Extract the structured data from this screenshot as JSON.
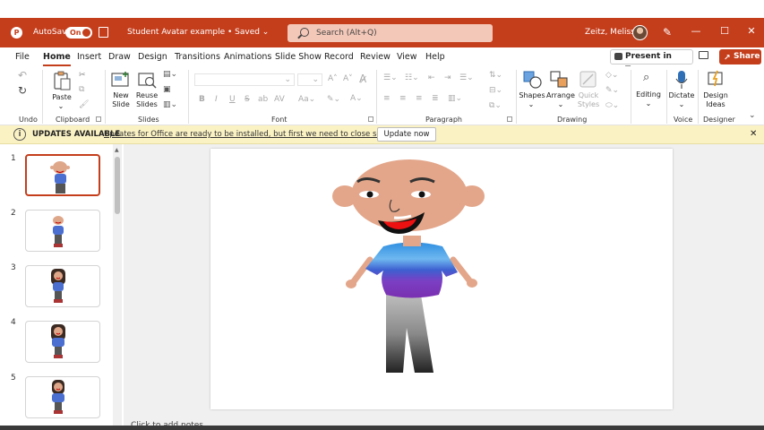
{
  "titlebar": {
    "autosave_label": "AutoSave",
    "autosave_state": "On",
    "doc_title": "Student Avatar example • Saved",
    "search_placeholder": "Search (Alt+Q)",
    "user_name": "Zeitz, Melissa",
    "accent_color": "#c43e1c"
  },
  "tabs": {
    "items": [
      "File",
      "Home",
      "Insert",
      "Draw",
      "Design",
      "Transitions",
      "Animations",
      "Slide Show",
      "Record",
      "Review",
      "View",
      "Help"
    ],
    "active": "Home",
    "present_label": "Present in Teams",
    "share_label": "Share"
  },
  "ribbon": {
    "groups": {
      "undo": "Undo",
      "clipboard": "Clipboard",
      "slides": "Slides",
      "font": "Font",
      "paragraph": "Paragraph",
      "drawing": "Drawing",
      "voice": "Voice",
      "designer": "Designer"
    },
    "buttons": {
      "paste": "Paste",
      "new_slide_1": "New",
      "new_slide_2": "Slide",
      "reuse_1": "Reuse",
      "reuse_2": "Slides",
      "shapes": "Shapes",
      "arrange": "Arrange",
      "quick_styles_1": "Quick",
      "quick_styles_2": "Styles",
      "editing": "Editing",
      "dictate": "Dictate",
      "design_ideas_1": "Design",
      "design_ideas_2": "Ideas"
    },
    "font_buttons": [
      "B",
      "I",
      "U",
      "S",
      "ab",
      "AV"
    ]
  },
  "update_bar": {
    "title": "UPDATES AVAILABLE",
    "message": "Updates for Office are ready to be installed, but first we need to close some apps.",
    "button": "Update now",
    "close": "✕"
  },
  "thumbnails": [
    {
      "number": "1",
      "selected": true
    },
    {
      "number": "2",
      "selected": false
    },
    {
      "number": "3",
      "selected": false
    },
    {
      "number": "4",
      "selected": false
    },
    {
      "number": "5",
      "selected": false
    }
  ],
  "notes_placeholder": "Click to add notes"
}
